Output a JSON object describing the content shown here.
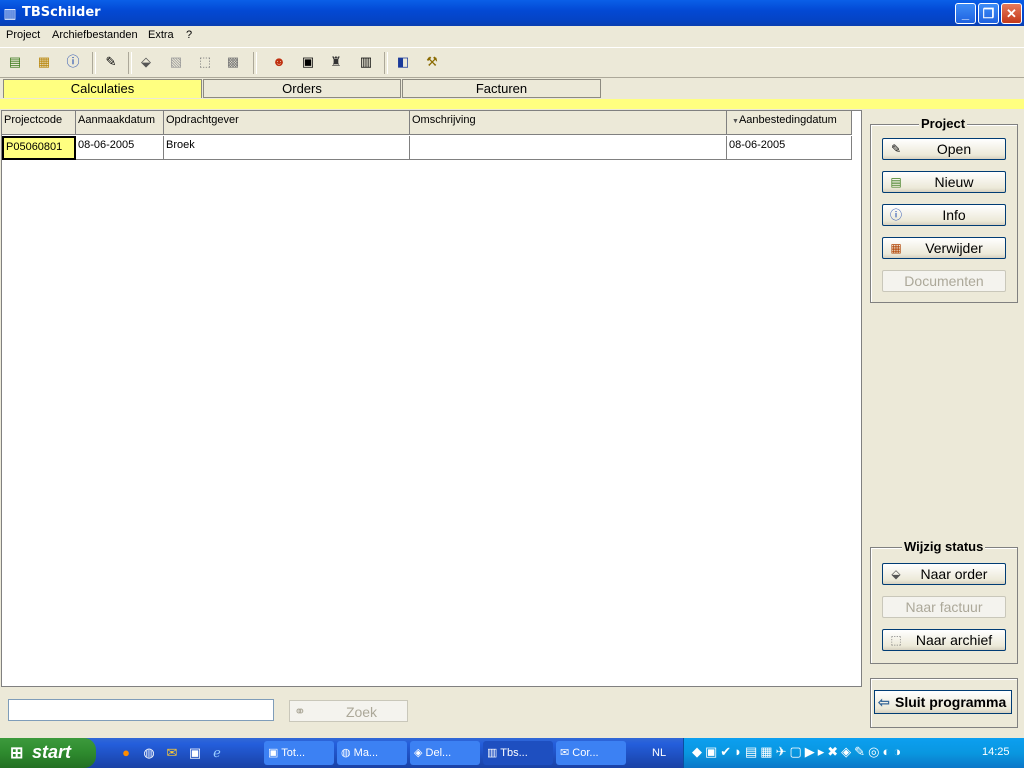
{
  "window": {
    "title": "TBSchilder",
    "app_icon": "tbschilder-app-icon"
  },
  "menu": [
    "Project",
    "Archiefbestanden",
    "Extra",
    "?"
  ],
  "tabs": [
    {
      "label": "Calculaties",
      "active": true
    },
    {
      "label": "Orders",
      "active": false
    },
    {
      "label": "Facturen",
      "active": false
    }
  ],
  "grid": {
    "columns": [
      "Projectcode",
      "Aanmaakdatum",
      "Opdrachtgever",
      "Omschrijving",
      "Aanbestedingdatum"
    ],
    "sorted_column": "Aanbestedingdatum",
    "rows": [
      {
        "projectcode": "P05060801",
        "aanmaakdatum": "08-06-2005",
        "opdrachtgever": "Broek",
        "omschrijving": "",
        "aanbestedingdatum": "08-06-2005"
      }
    ]
  },
  "project_panel": {
    "title": "Project",
    "buttons": [
      {
        "label": "Open",
        "icon": "open-icon",
        "enabled": true
      },
      {
        "label": "Nieuw",
        "icon": "new-project-icon",
        "enabled": true
      },
      {
        "label": "Info",
        "icon": "info-icon",
        "enabled": true
      },
      {
        "label": "Verwijder",
        "icon": "delete-icon",
        "enabled": true
      },
      {
        "label": "Documenten",
        "icon": "",
        "enabled": false
      }
    ]
  },
  "status_panel": {
    "title": "Wijzig status",
    "buttons": [
      {
        "label": "Naar order",
        "icon": "order-icon",
        "enabled": true
      },
      {
        "label": "Naar factuur",
        "icon": "",
        "enabled": false
      },
      {
        "label": "Naar archief",
        "icon": "archive-icon",
        "enabled": true
      }
    ]
  },
  "search": {
    "value": "",
    "button_label": "Zoek"
  },
  "close_button": "Sluit programma",
  "taskbar": {
    "start_label": "start",
    "tasks": [
      {
        "label": "Tot...",
        "active": false
      },
      {
        "label": "Ma...",
        "active": false
      },
      {
        "label": "Del...",
        "active": false
      },
      {
        "label": "Tbs...",
        "active": true
      },
      {
        "label": "Cor...",
        "active": false
      }
    ],
    "language": "NL",
    "clock": "14:25"
  },
  "colors": {
    "highlight": "#ffff80",
    "titlebar": "#0349d4",
    "taskbar": "#245edb"
  }
}
